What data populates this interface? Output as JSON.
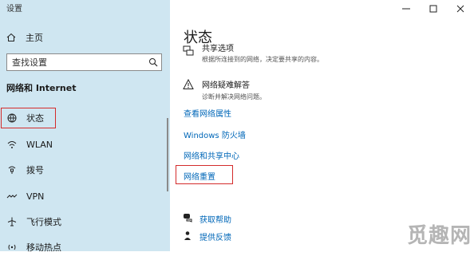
{
  "window": {
    "title": "设置"
  },
  "sidebar": {
    "home_label": "主页",
    "search_placeholder": "查找设置",
    "section_title": "网络和 Internet",
    "items": [
      {
        "label": "状态",
        "icon": "globe-status-icon",
        "selected": true
      },
      {
        "label": "WLAN",
        "icon": "wifi-icon"
      },
      {
        "label": "拨号",
        "icon": "dialup-icon"
      },
      {
        "label": "VPN",
        "icon": "vpn-icon"
      },
      {
        "label": "飞行模式",
        "icon": "airplane-icon"
      },
      {
        "label": "移动热点",
        "icon": "hotspot-icon"
      }
    ]
  },
  "main": {
    "title": "状态",
    "share": {
      "title": "共享选项",
      "desc": "根据所连接到的网络，决定要共享的内容。"
    },
    "troubleshoot": {
      "title": "网络疑难解答",
      "desc": "诊断并解决网络问题。"
    },
    "links": {
      "props": "查看网络属性",
      "firewall": "Windows 防火墙",
      "center": "网络和共享中心",
      "reset": "网络重置"
    },
    "help": {
      "get_help": "获取帮助",
      "feedback": "提供反馈"
    }
  },
  "watermark": "觅趣网",
  "colors": {
    "sidebar_bg": "#cfe6f1",
    "link": "#0067b8",
    "highlight": "#d42b2b"
  }
}
